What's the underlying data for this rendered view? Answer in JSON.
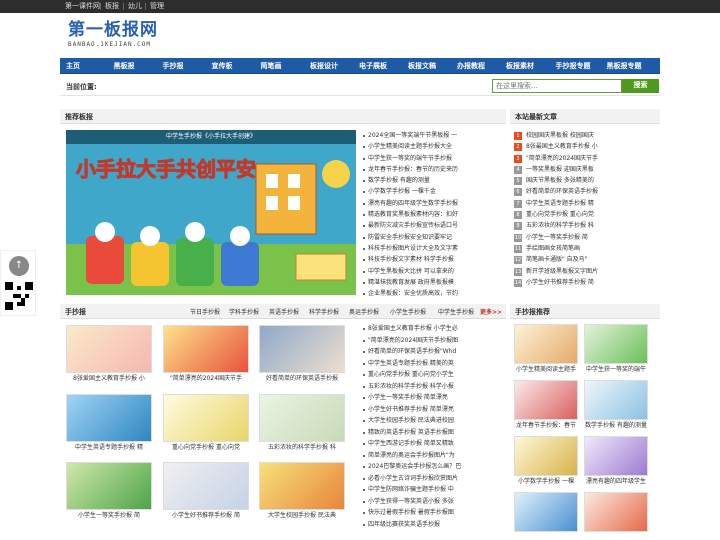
{
  "topbar": {
    "links": [
      "第一课件网",
      "板报",
      "幼儿",
      "管理"
    ]
  },
  "logo": {
    "title": "第一板报网",
    "subtitle": "BANBAO.1KEJIAN.COM"
  },
  "nav": [
    "主页",
    "黑板报",
    "手抄报",
    "宣传板",
    "简笔画",
    "板报设计",
    "电子展板",
    "板报文稿",
    "办报教程",
    "板报素材",
    "手抄报专题",
    "黑板报专题"
  ],
  "crumb": {
    "label": "当前位置:",
    "search_placeholder": "在这里搜索...",
    "search_button": "搜索"
  },
  "recommend": {
    "title": "推荐板报",
    "hero_caption": "中学生手抄报《小手拉大手创建》",
    "hero_art_title": "小手拉大手共创平安",
    "items": [
      "2024全国一等奖端午节黑板报 一",
      "小学生精美阅读主题手抄报大全",
      "中学生获一等奖的端午节手抄报",
      "龙年春节手抄报：春节的历史来历",
      "数学手抄报 有趣的测量",
      "小学数学手抄报 一棵千金",
      "漂亮有趣的四年级学生数学手抄报",
      "精选教育奖黑板报素材内容：扣好",
      "最新防灾减灾手抄报宣传标语口号",
      "防雷安全手抄报安全知识要牢记",
      "科技手抄报图片设计大全及文字素",
      "科技手抄报文字素材 科学手抄报",
      "中学生黑板报大比拼 可以拿来的",
      "精湛抹我教育发展 政府黑板报模",
      "企业黑板报：安全优质高效，节约"
    ]
  },
  "latest": {
    "title": "本站最新文章",
    "items": [
      "校园国庆黑板报 校园国庆",
      "8张最国主义教育手抄报 小",
      "\"简单漂亮的2024国庆节手",
      "一等奖黑板报 迎国庆黑板",
      "国庆节黑板报 多张精美的",
      "好看简单的环保英语手抄报",
      "中学生英语专题手抄报 精",
      "重心向党手抄报 重心向党",
      "五彩浓妆的科学手抄报 科",
      "小学生一等奖手抄报 简",
      "手绘图画女孩简笔画",
      "简笔画卡通版\" 自及马\"",
      "新开学班级黑板报文字图片",
      "小学生好书推荐手抄报 简"
    ]
  },
  "handbook": {
    "title": "手抄报",
    "tabs": [
      "节日手抄报",
      "学科手抄报",
      "英语手抄报",
      "科学手抄报",
      "奥运手抄报",
      "小学生手抄报",
      "中学生手抄报"
    ],
    "more": "更多>>",
    "cards": [
      "8张爱国主义教育手抄报 小",
      "\"简单漂亮的2024国庆节手",
      "好看简单的环保英语手抄报",
      "中学生英语专题手抄报 精",
      "重心向党手抄报 重心向党",
      "五彩浓妆的科学手抄报 科",
      "小学生一等奖手抄报 简",
      "小学生好书推荐手抄报 简",
      "大学生校园手抄报 民法典"
    ],
    "list": [
      "8张爱国主义教育手抄报 小学生必",
      "\"简单漂亮的2024国庆节手抄报图",
      "好看简单的环保英语手抄报\"Whd",
      "中学生英语专题手抄报 精美的英",
      "重心向党手抄报 重心向党小学生",
      "五彩浓妆的科学手抄报 科学小报",
      "小学生一等奖手抄报 简单漂亮",
      "小学生好书推荐手抄报 简单漂亮",
      "大学生校园手抄报 民法典进校园",
      "精致的英语手抄报 英语手抄报图",
      "中学生西游记手抄报 简单又精致",
      "简单漂亮的奥运会手抄报图片\"为",
      "2024巴黎奥运会手抄报怎么画？巴",
      "必看小学生古诗词手抄报欣赏图片",
      "中学生防网络诈骗主题手抄报 中",
      "小学生获得一等奖英语小报 多张",
      "快乐过暑假手抄报 暑假手抄报图",
      "四年级比赛获奖英语手抄报",
      "端午节手抄报图片精致内容\"在绵"
    ]
  },
  "hot": {
    "title": "手抄报推荐",
    "cards": [
      "小学生精美阅读主题手",
      "中学生获一等奖的端午",
      "龙年春节手抄报：春节",
      "数学手抄报 有趣的测量",
      "小学数学手抄报 一棵",
      "漂亮有趣的四年级学生",
      "",
      ""
    ]
  },
  "colors": {
    "nav": "#1e5aa6",
    "search_button": "#4e9a1e",
    "hot_rank": "#e94b1d"
  }
}
